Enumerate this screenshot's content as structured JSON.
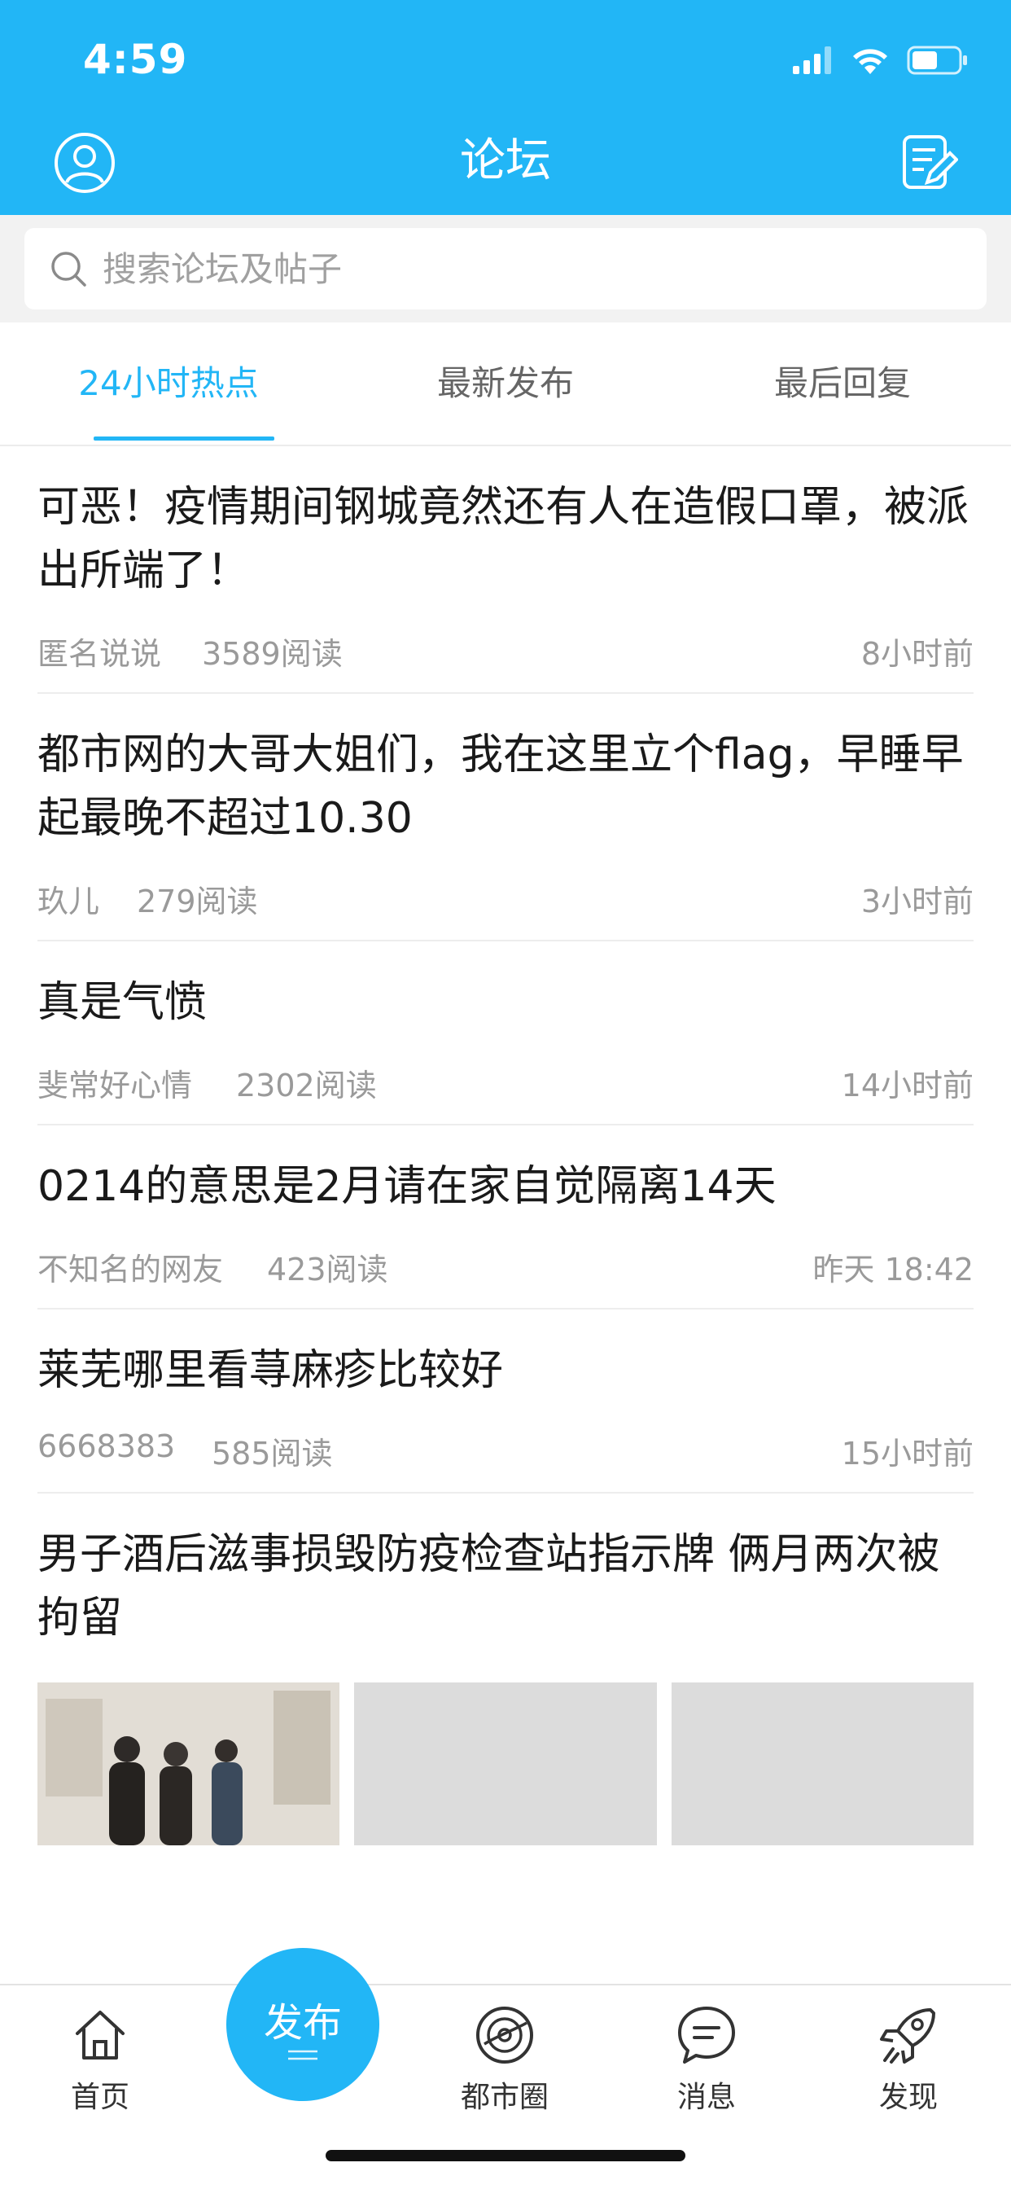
{
  "status_bar": {
    "time": "4:59"
  },
  "header": {
    "title": "论坛"
  },
  "search": {
    "placeholder": "搜索论坛及帖子"
  },
  "tabs": [
    {
      "label": "24小时热点",
      "active": true
    },
    {
      "label": "最新发布",
      "active": false
    },
    {
      "label": "最后回复",
      "active": false
    }
  ],
  "posts": [
    {
      "title": "可恶！疫情期间钢城竟然还有人在造假口罩，被派出所端了！",
      "author": "匿名说说",
      "reads": "3589阅读",
      "time": "8小时前"
    },
    {
      "title": "都市网的大哥大姐们，我在这里立个flag，早睡早起最晚不超过10.30",
      "author": "玖儿",
      "reads": "279阅读",
      "time": "3小时前"
    },
    {
      "title": "真是气愤",
      "author": "斐常好心情",
      "reads": "2302阅读",
      "time": "14小时前"
    },
    {
      "title": "0214的意思是2月请在家自觉隔离14天",
      "author": "不知名的网友",
      "reads": "423阅读",
      "time": "昨天 18:42"
    },
    {
      "title": "莱芜哪里看荨麻疹比较好",
      "author": "6668383",
      "reads": "585阅读",
      "time": "15小时前"
    },
    {
      "title": "男子酒后滋事损毁防疫检查站指示牌 俩月两次被拘留",
      "has_images": true
    }
  ],
  "bottom_tabs": {
    "home": "首页",
    "publish": "发布",
    "circle": "都市圈",
    "messages": "消息",
    "discover": "发现"
  },
  "colors": {
    "accent": "#22b6f6"
  }
}
